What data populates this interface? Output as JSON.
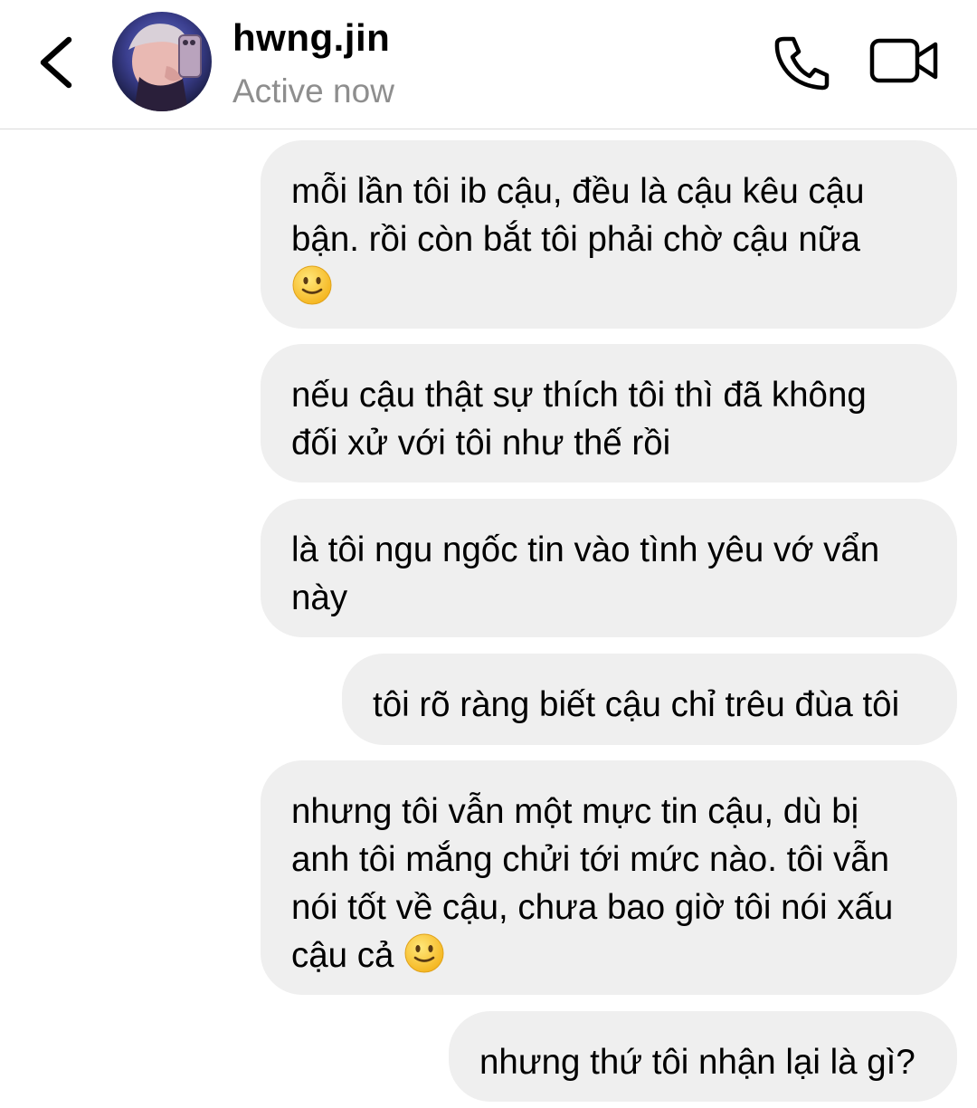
{
  "header": {
    "contact_name": "hwng.jin",
    "status": "Active now",
    "back_icon": "chevron-left-icon",
    "call_icon": "phone-icon",
    "video_icon": "video-camera-icon"
  },
  "messages": [
    {
      "text": "mỗi lần tôi ib cậu, đều là cậu kêu cậu\nbận. rồi còn bắt tôi phải chờ cậu nữa\n",
      "emoji": "slightly-smiling-face"
    },
    {
      "text": "nếu cậu thật sự thích tôi thì đã không\nđối xử với tôi như thế rồi"
    },
    {
      "text": "là tôi ngu ngốc tin vào tình yêu vớ vẩn\nnày"
    },
    {
      "text": "tôi rõ ràng biết cậu chỉ trêu đùa tôi"
    },
    {
      "text": "nhưng tôi vẫn một mực tin cậu, dù bị\nanh tôi mắng chửi tới mức nào. tôi vẫn\nnói tốt về cậu, chưa bao giờ tôi nói xấu\ncậu cả ",
      "emoji": "slightly-smiling-face"
    },
    {
      "text": "nhưng thứ tôi nhận lại là gì?"
    }
  ],
  "colors": {
    "bubble": "#efefef",
    "status_text": "#8e8e8e",
    "divider": "#dbdbdb"
  }
}
